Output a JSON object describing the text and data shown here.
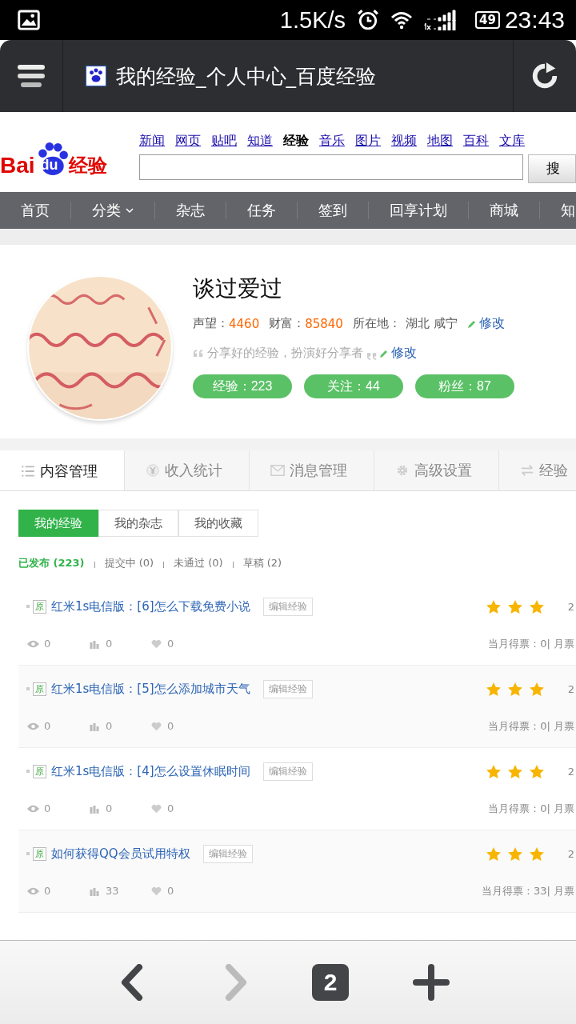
{
  "status_bar": {
    "speed": "1.5K/s",
    "battery": "49",
    "time": "23:43"
  },
  "browser": {
    "title": "我的经验_个人中心_百度经验"
  },
  "header": {
    "logo_text": "Bai",
    "logo_du": "du",
    "logo_suffix": "经验",
    "search_button": "搜",
    "links": [
      {
        "label": "新闻",
        "selected": false
      },
      {
        "label": "网页",
        "selected": false
      },
      {
        "label": "贴吧",
        "selected": false
      },
      {
        "label": "知道",
        "selected": false
      },
      {
        "label": "经验",
        "selected": true
      },
      {
        "label": "音乐",
        "selected": false
      },
      {
        "label": "图片",
        "selected": false
      },
      {
        "label": "视频",
        "selected": false
      },
      {
        "label": "地图",
        "selected": false
      },
      {
        "label": "百科",
        "selected": false
      },
      {
        "label": "文库",
        "selected": false
      }
    ]
  },
  "nav": [
    {
      "label": "首页",
      "has_menu": false
    },
    {
      "label": "分类",
      "has_menu": true
    },
    {
      "label": "杂志",
      "has_menu": false
    },
    {
      "label": "任务",
      "has_menu": false
    },
    {
      "label": "签到",
      "has_menu": false
    },
    {
      "label": "回享计划",
      "has_menu": false
    },
    {
      "label": "商城",
      "has_menu": false
    },
    {
      "label": "知",
      "has_menu": false
    }
  ],
  "profile": {
    "name": "谈过爱过",
    "reputation_label": "声望：",
    "reputation": "4460",
    "wealth_label": "财富：",
    "wealth": "85840",
    "location_label": "所在地：",
    "location": "湖北 咸宁",
    "edit": "修改",
    "motto": "分享好的经验，扮演好分享者",
    "motto_edit": "修改",
    "stats": [
      "经验：223",
      "关注：44",
      "粉丝：87"
    ]
  },
  "tabs": [
    {
      "label": "内容管理",
      "kind": "list",
      "selected": true
    },
    {
      "label": "收入统计",
      "kind": "yen",
      "selected": false
    },
    {
      "label": "消息管理",
      "kind": "mail",
      "selected": false
    },
    {
      "label": "高级设置",
      "kind": "gear",
      "selected": false
    },
    {
      "label": "经验",
      "kind": "swap",
      "selected": false
    }
  ],
  "subtabs": [
    {
      "label": "我的经验",
      "selected": true
    },
    {
      "label": "我的杂志",
      "selected": false
    },
    {
      "label": "我的收藏",
      "selected": false
    }
  ],
  "filters": [
    {
      "label": "已发布 (223)",
      "selected": true
    },
    {
      "label": "提交中 (0)",
      "selected": false
    },
    {
      "label": "未通过 (0)",
      "selected": false
    },
    {
      "label": "草稿 (2)",
      "selected": false
    }
  ],
  "rows": [
    {
      "badge": "原",
      "title": "红米1s电信版：[6]怎么下载免费小说",
      "edit": "编辑经验",
      "stars": 3,
      "column_3": "2",
      "views": "0",
      "votes": "0",
      "likes": "0",
      "monthly": "当月得票：0| 月票"
    },
    {
      "badge": "原",
      "title": "红米1s电信版：[5]怎么添加城市天气",
      "edit": "编辑经验",
      "stars": 3,
      "column_3": "2",
      "views": "0",
      "votes": "0",
      "likes": "0",
      "monthly": "当月得票：0| 月票"
    },
    {
      "badge": "原",
      "title": "红米1s电信版：[4]怎么设置休眠时间",
      "edit": "编辑经验",
      "stars": 3,
      "column_3": "2",
      "views": "0",
      "votes": "0",
      "likes": "0",
      "monthly": "当月得票：0| 月票"
    },
    {
      "badge": "原",
      "title": "如何获得QQ会员试用特权",
      "edit": "编辑经验",
      "stars": 3,
      "column_3": "2",
      "views": "0",
      "votes": "33",
      "likes": "0",
      "monthly": "当月得票：33| 月票"
    }
  ],
  "bottom_bar": {
    "back_enabled": true,
    "forward_enabled": false,
    "tab_count": "2"
  }
}
